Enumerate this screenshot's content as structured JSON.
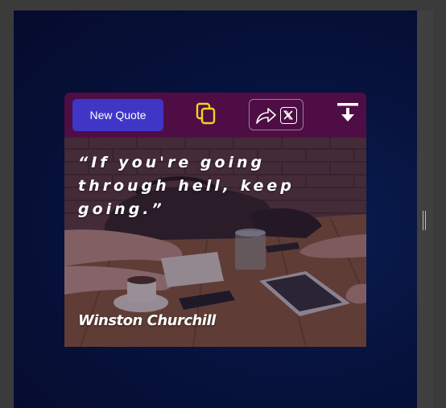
{
  "toolbar": {
    "new_quote_label": "New Quote",
    "copy_icon": "copy-icon",
    "share_icon": "share-arrow-icon",
    "x_icon": "x-logo-icon",
    "download_icon": "download-icon"
  },
  "quote": {
    "text": "“If you're going through hell, keep going.”",
    "author": "Winston Churchill"
  },
  "colors": {
    "toolbar_bg": "#4f0d45",
    "button_bg": "#3f35c6",
    "copy_icon": "#f2d024",
    "page_bg": "#07133e"
  }
}
